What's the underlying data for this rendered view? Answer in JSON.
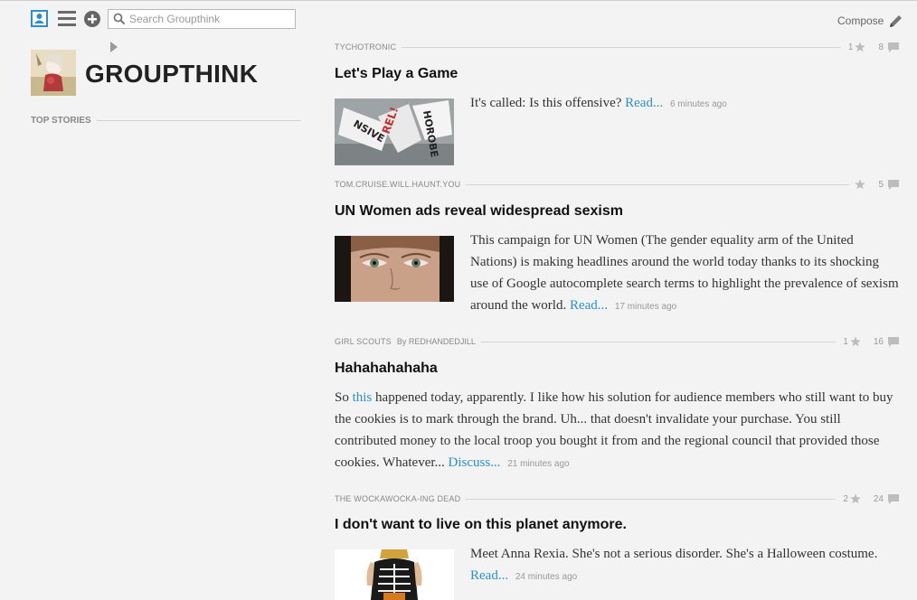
{
  "search": {
    "placeholder": "Search Groupthink"
  },
  "compose": {
    "label": "Compose"
  },
  "sidebar": {
    "title": "GROUPTHINK",
    "section": "TOP STORIES"
  },
  "posts": [
    {
      "group": "TYCHOTRONIC",
      "by": "",
      "stars": "1",
      "comments": "8",
      "title": "Let's Play a Game",
      "text": "It's called: Is this offensive?",
      "link": "Read...",
      "time": "6 minutes ago"
    },
    {
      "group": "TOM.CRUISE.WILL.HAUNT.YOU",
      "by": "",
      "stars": "",
      "comments": "5",
      "title": "UN Women ads reveal widespread sexism",
      "text": "This campaign for UN Women (The gender equality arm of the United Nations) is making headlines around the world today thanks to its shocking use of Google autocomplete search terms to highlight the prevalence of sexism around the world.",
      "link": "Read...",
      "time": "17 minutes ago"
    },
    {
      "group": "GIRL SCOUTS",
      "by": "By REDHANDEDJILL",
      "stars": "1",
      "comments": "16",
      "title": "Hahahahahaha",
      "pre": "So ",
      "inline_link": "this",
      "text": " happened today, apparently. I like how his solution for audience members who still want to buy the cookies is to mark through the brand. Uh... that doesn't invalidate your purchase. You still contributed money to the local troop you bought it from and the regional council that provided those cookies. Whatever...",
      "link": "Discuss...",
      "time": "21 minutes ago"
    },
    {
      "group": "THE WOCKAWOCKA-ING DEAD",
      "by": "",
      "stars": "2",
      "comments": "24",
      "title": "I don't want to live on this planet anymore.",
      "text": "Meet Anna Rexia. She's not a serious disorder. She's a Halloween costume.",
      "link": "Read...",
      "time": "24 minutes ago"
    }
  ],
  "colors": {
    "link": "#2a8fd0",
    "background": "#f3f3f3"
  }
}
